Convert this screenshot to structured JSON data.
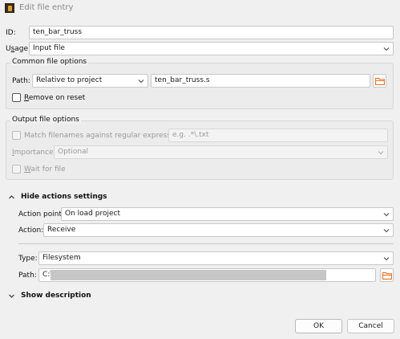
{
  "window": {
    "title": "Edit file entry"
  },
  "id_field": {
    "label": "ID:",
    "value": "ten_bar_truss"
  },
  "usage": {
    "label_pre": "U",
    "label_u": "s",
    "label_post": "age:",
    "value": "Input file"
  },
  "common": {
    "title": "Common file options",
    "path_label": "Path:",
    "path_mode": "Relative to project",
    "path_value": "ten_bar_truss.s",
    "remove_pre": "",
    "remove_u": "R",
    "remove_post": "emove on reset"
  },
  "output": {
    "title": "Output file options",
    "match_label": "Match filenames against regular expression:",
    "regex_placeholder": "e.g. .*\\.txt",
    "importance_u": "I",
    "importance_post": "mportance:",
    "importance_value": "Optional",
    "wait_u": "W",
    "wait_post": "ait for file"
  },
  "actions": {
    "toggle_label": "Hide actions settings",
    "action_point_label": "Action point:",
    "action_point_value": "On load project",
    "action_label": "Action:",
    "action_value": "Receive",
    "type_label": "Type:",
    "type_value": "Filesystem",
    "path_label": "Path:",
    "path_value": "C:\\"
  },
  "description": {
    "toggle_label": "Show description"
  },
  "buttons": {
    "ok": "OK",
    "cancel": "Cancel"
  },
  "colors": {
    "folder_icon": "#e8742a",
    "background": "#f0f0f0"
  }
}
